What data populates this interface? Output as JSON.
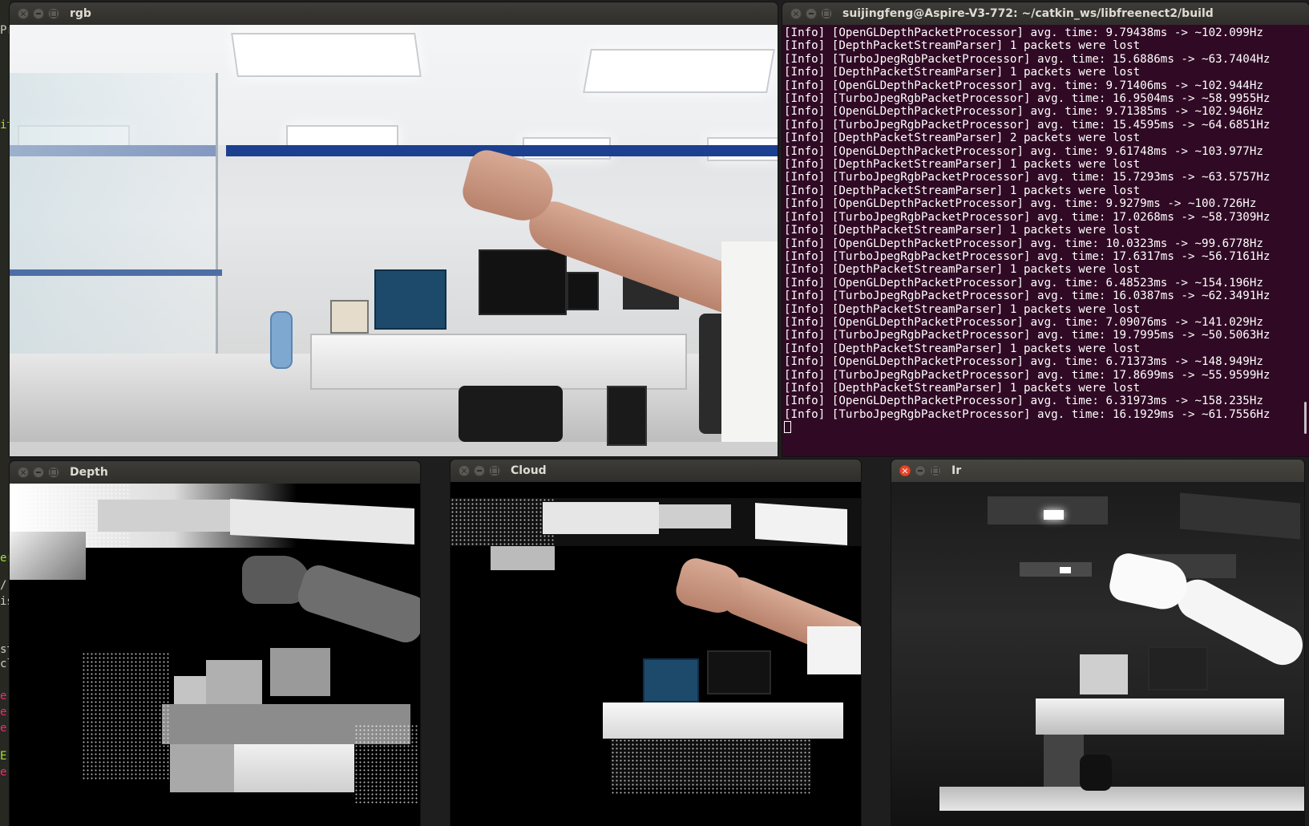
{
  "windows": {
    "rgb": {
      "title": "rgb"
    },
    "terminal": {
      "title": "suijingfeng@Aspire-V3-772: ~/catkin_ws/libfreenect2/build",
      "lines": [
        "[Info] [OpenGLDepthPacketProcessor] avg. time: 9.79438ms -> ~102.099Hz",
        "[Info] [DepthPacketStreamParser] 1 packets were lost",
        "[Info] [TurboJpegRgbPacketProcessor] avg. time: 15.6886ms -> ~63.7404Hz",
        "[Info] [DepthPacketStreamParser] 1 packets were lost",
        "[Info] [OpenGLDepthPacketProcessor] avg. time: 9.71406ms -> ~102.944Hz",
        "[Info] [TurboJpegRgbPacketProcessor] avg. time: 16.9504ms -> ~58.9955Hz",
        "[Info] [OpenGLDepthPacketProcessor] avg. time: 9.71385ms -> ~102.946Hz",
        "[Info] [TurboJpegRgbPacketProcessor] avg. time: 15.4595ms -> ~64.6851Hz",
        "[Info] [DepthPacketStreamParser] 2 packets were lost",
        "[Info] [OpenGLDepthPacketProcessor] avg. time: 9.61748ms -> ~103.977Hz",
        "[Info] [DepthPacketStreamParser] 1 packets were lost",
        "[Info] [TurboJpegRgbPacketProcessor] avg. time: 15.7293ms -> ~63.5757Hz",
        "[Info] [DepthPacketStreamParser] 1 packets were lost",
        "[Info] [OpenGLDepthPacketProcessor] avg. time: 9.9279ms -> ~100.726Hz",
        "[Info] [TurboJpegRgbPacketProcessor] avg. time: 17.0268ms -> ~58.7309Hz",
        "[Info] [DepthPacketStreamParser] 1 packets were lost",
        "[Info] [OpenGLDepthPacketProcessor] avg. time: 10.0323ms -> ~99.6778Hz",
        "[Info] [TurboJpegRgbPacketProcessor] avg. time: 17.6317ms -> ~56.7161Hz",
        "[Info] [DepthPacketStreamParser] 1 packets were lost",
        "[Info] [OpenGLDepthPacketProcessor] avg. time: 6.48523ms -> ~154.196Hz",
        "[Info] [TurboJpegRgbPacketProcessor] avg. time: 16.0387ms -> ~62.3491Hz",
        "[Info] [DepthPacketStreamParser] 1 packets were lost",
        "[Info] [OpenGLDepthPacketProcessor] avg. time: 7.09076ms -> ~141.029Hz",
        "[Info] [TurboJpegRgbPacketProcessor] avg. time: 19.7995ms -> ~50.5063Hz",
        "[Info] [DepthPacketStreamParser] 1 packets were lost",
        "[Info] [OpenGLDepthPacketProcessor] avg. time: 6.71373ms -> ~148.949Hz",
        "[Info] [TurboJpegRgbPacketProcessor] avg. time: 17.8699ms -> ~55.9599Hz",
        "[Info] [DepthPacketStreamParser] 1 packets were lost",
        "[Info] [OpenGLDepthPacketProcessor] avg. time: 6.31973ms -> ~158.235Hz",
        "[Info] [TurboJpegRgbPacketProcessor] avg. time: 16.1929ms -> ~61.7556Hz"
      ]
    },
    "depth": {
      "title": "Depth"
    },
    "cloud": {
      "title": "Cloud"
    },
    "ir": {
      "title": "Ir"
    }
  },
  "background_editor": {
    "fragments": [
      {
        "text": "Pr",
        "color": "#cfcfc2"
      },
      {
        "text": "it",
        "color": "#a6e22e"
      },
      {
        "text": "er",
        "color": "#a6e22e"
      },
      {
        "text": "/",
        "color": "#cfcfc2"
      },
      {
        "text": "is",
        "color": "#cfcfc2"
      },
      {
        "text": "st",
        "color": "#cfcfc2"
      },
      {
        "text": "cl",
        "color": "#cfcfc2"
      },
      {
        "text": "e",
        "color": "#f92672"
      },
      {
        "text": "e",
        "color": "#f92672"
      },
      {
        "text": "e",
        "color": "#f92672"
      },
      {
        "text": "E",
        "color": "#a6e22e"
      },
      {
        "text": "e",
        "color": "#f92672"
      }
    ]
  },
  "colors": {
    "terminal_bg": "#300a24",
    "close_active": "#e7482a",
    "titlebar": "#3d3c38"
  }
}
